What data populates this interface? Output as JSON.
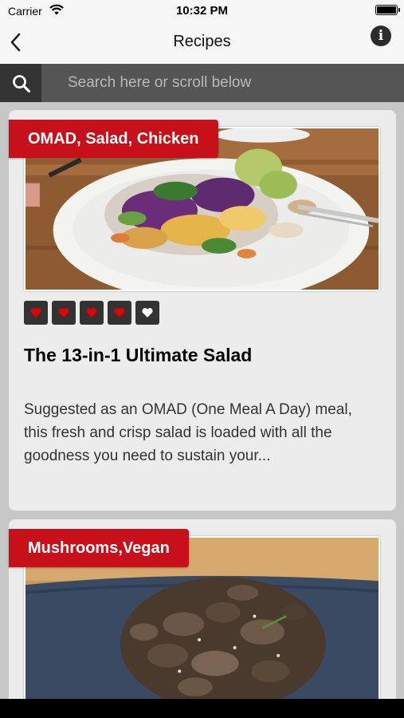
{
  "status_bar": {
    "carrier": "Carrier",
    "time": "10:32 PM"
  },
  "nav": {
    "title": "Recipes",
    "back_icon": "chevron-left",
    "info_icon": "info-circle",
    "info_glyph": "i"
  },
  "search": {
    "placeholder": "Search here or scroll below",
    "value": "",
    "icon": "magnifier"
  },
  "recipes": [
    {
      "tags": "OMAD, Salad, Chicken",
      "rating": 4,
      "rating_max": 5,
      "title": "The 13-in-1 Ultimate Salad",
      "description": "Suggested as an OMAD (One Meal A Day) meal, this fresh and crisp salad is loaded with all the goodness you need to sustain your..."
    },
    {
      "tags": "Mushrooms,Vegan"
    }
  ],
  "colors": {
    "accent": "#c8101a",
    "heart_filled": "#e00000",
    "heart_empty": "#ffffff",
    "heart_box": "#333333",
    "search_bar": "#333333",
    "card": "#ececec",
    "background": "#c7c7c7"
  }
}
